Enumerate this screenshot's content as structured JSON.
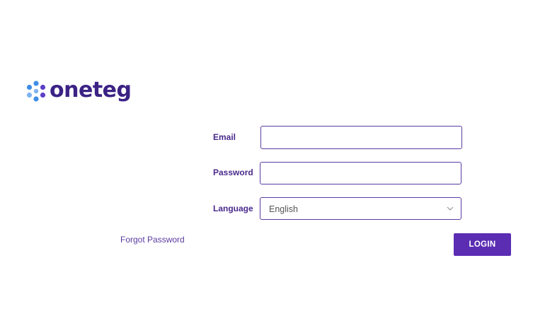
{
  "brand": {
    "name": "oneteg",
    "logo_icon": "flower-dots-icon",
    "colors": {
      "text": "#3b2284",
      "dot_blue": "#3f8ee6",
      "dot_purple": "#5e3fc7",
      "dot_light": "#7fb3f0"
    }
  },
  "form": {
    "email": {
      "label": "Email",
      "value": "",
      "placeholder": ""
    },
    "password": {
      "label": "Password",
      "value": "",
      "placeholder": ""
    },
    "language": {
      "label": "Language",
      "selected": "English",
      "icon": "chevron-down-icon"
    },
    "forgot_password": "Forgot Password",
    "login_button": "LOGIN"
  },
  "colors": {
    "label_purple": "#4a2a8c",
    "input_border": "#5b3aa3",
    "button_bg": "#5a2db3",
    "link_purple": "#5b3aa3",
    "select_text": "#555555",
    "chevron": "#999999"
  }
}
